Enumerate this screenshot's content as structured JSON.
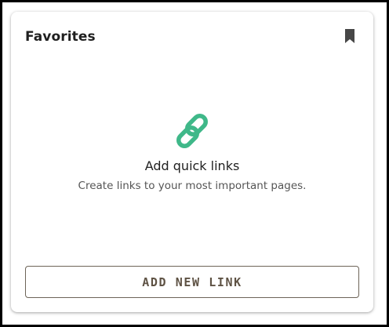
{
  "card": {
    "title": "Favorites"
  },
  "icons": {
    "bookmark": "bookmark-icon",
    "link": "link-icon"
  },
  "empty_state": {
    "title": "Add quick links",
    "subtitle": "Create links to your most important pages."
  },
  "actions": {
    "add_link_label": "ADD NEW LINK"
  },
  "colors": {
    "accent": "#3fb889",
    "button_text": "#5e5244",
    "button_border": "#6d6458",
    "bookmark": "#474747"
  }
}
